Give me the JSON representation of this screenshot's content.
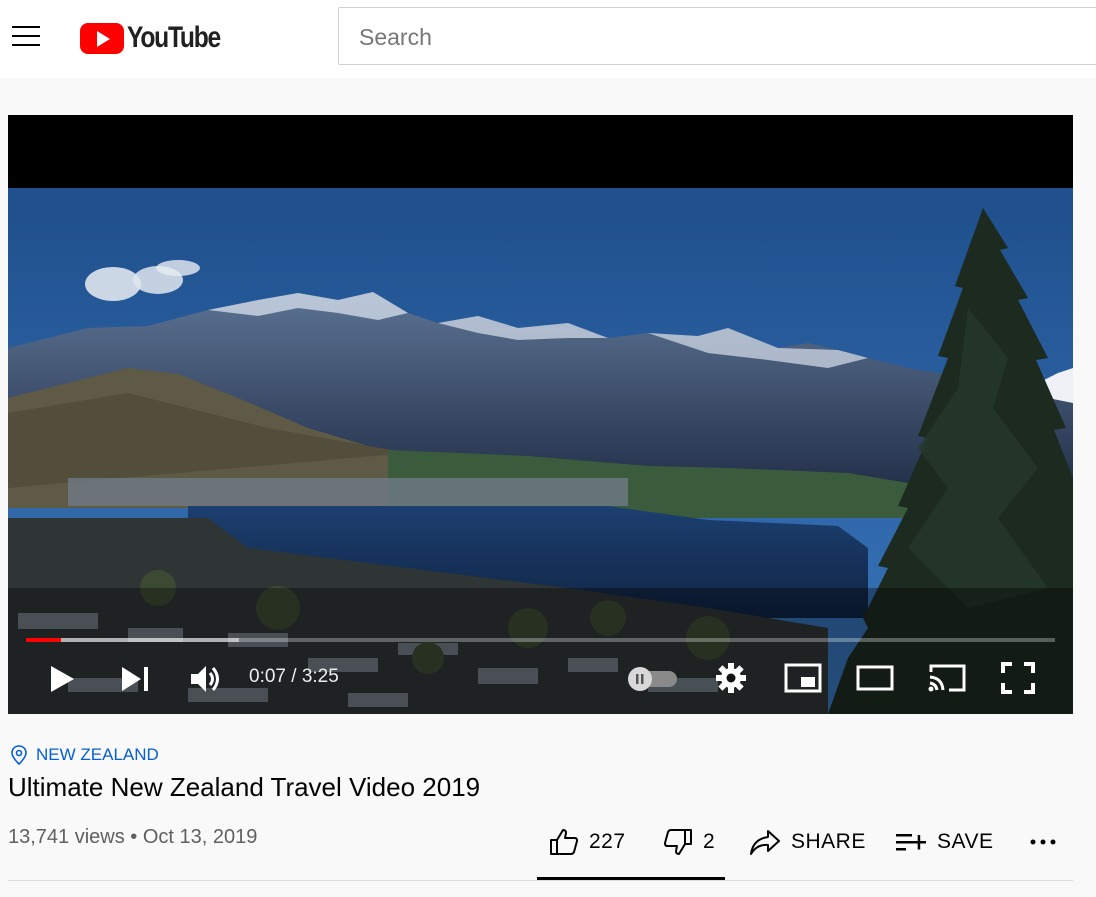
{
  "header": {
    "logo_text": "YouTube",
    "search_placeholder": "Search"
  },
  "player": {
    "time_current": "0:07",
    "time_separator": " / ",
    "time_total": "3:25",
    "progress_played_fraction": 0.034,
    "progress_buffered_fraction": 0.207,
    "autoplay": "off"
  },
  "video": {
    "location": "NEW ZEALAND",
    "title": "Ultimate New Zealand Travel Video 2019",
    "views": "13,741 views",
    "separator": " • ",
    "date": "Oct 13, 2019"
  },
  "actions": {
    "likes": "227",
    "dislikes": "2",
    "share_label": "SHARE",
    "save_label": "SAVE"
  },
  "colors": {
    "brand_red": "#ff0000",
    "link_blue": "#065fd4",
    "text_secondary": "#606060"
  }
}
